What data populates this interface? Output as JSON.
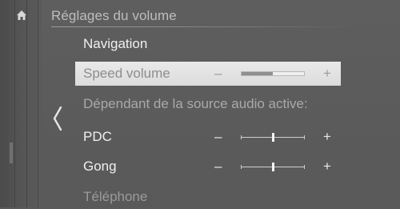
{
  "header": {
    "title": "Réglages du volume"
  },
  "icons": {
    "home": "home-icon",
    "back": "chevron-left-icon"
  },
  "menu": {
    "navigation": {
      "label": "Navigation"
    },
    "speed_volume": {
      "label": "Speed volume",
      "minus": "–",
      "plus": "+",
      "level": 0.5
    },
    "dependent_source": {
      "label": "Dépendant de la source audio active:"
    },
    "pdc": {
      "label": "PDC",
      "minus": "–",
      "plus": "+",
      "level": 0.5
    },
    "gong": {
      "label": "Gong",
      "minus": "–",
      "plus": "+",
      "level": 0.5
    },
    "telephone": {
      "label": "Téléphone"
    }
  },
  "colors": {
    "background": "#5a5a5a",
    "highlight": "#e4e4e4",
    "text": "#f0f0f0",
    "muted_text": "#a9a9a9"
  }
}
